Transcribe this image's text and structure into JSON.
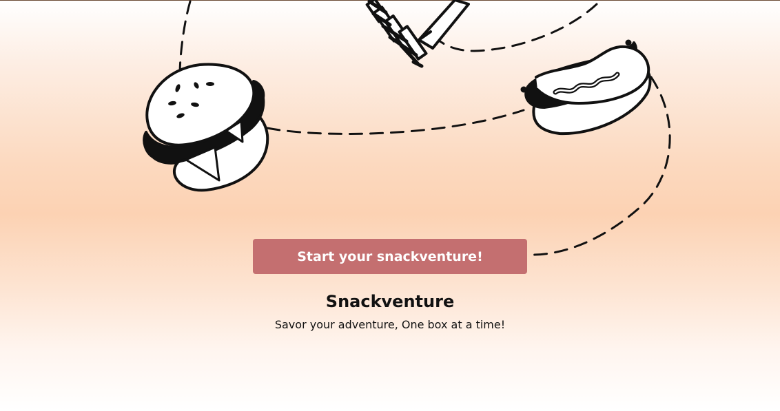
{
  "hero": {
    "cta_label": "Start your snackventure!",
    "brand_name": "Snackventure",
    "tagline": "Savor your adventure, One box at a time!"
  },
  "illustrations": {
    "icons": [
      "burger-icon",
      "fries-icon",
      "hotdog-icon"
    ],
    "path_style": "dashed"
  },
  "colors": {
    "cta_background": "#c46f70",
    "cta_text": "#ffffff",
    "text": "#111111",
    "gradient_peach": "#fcd2b3"
  }
}
